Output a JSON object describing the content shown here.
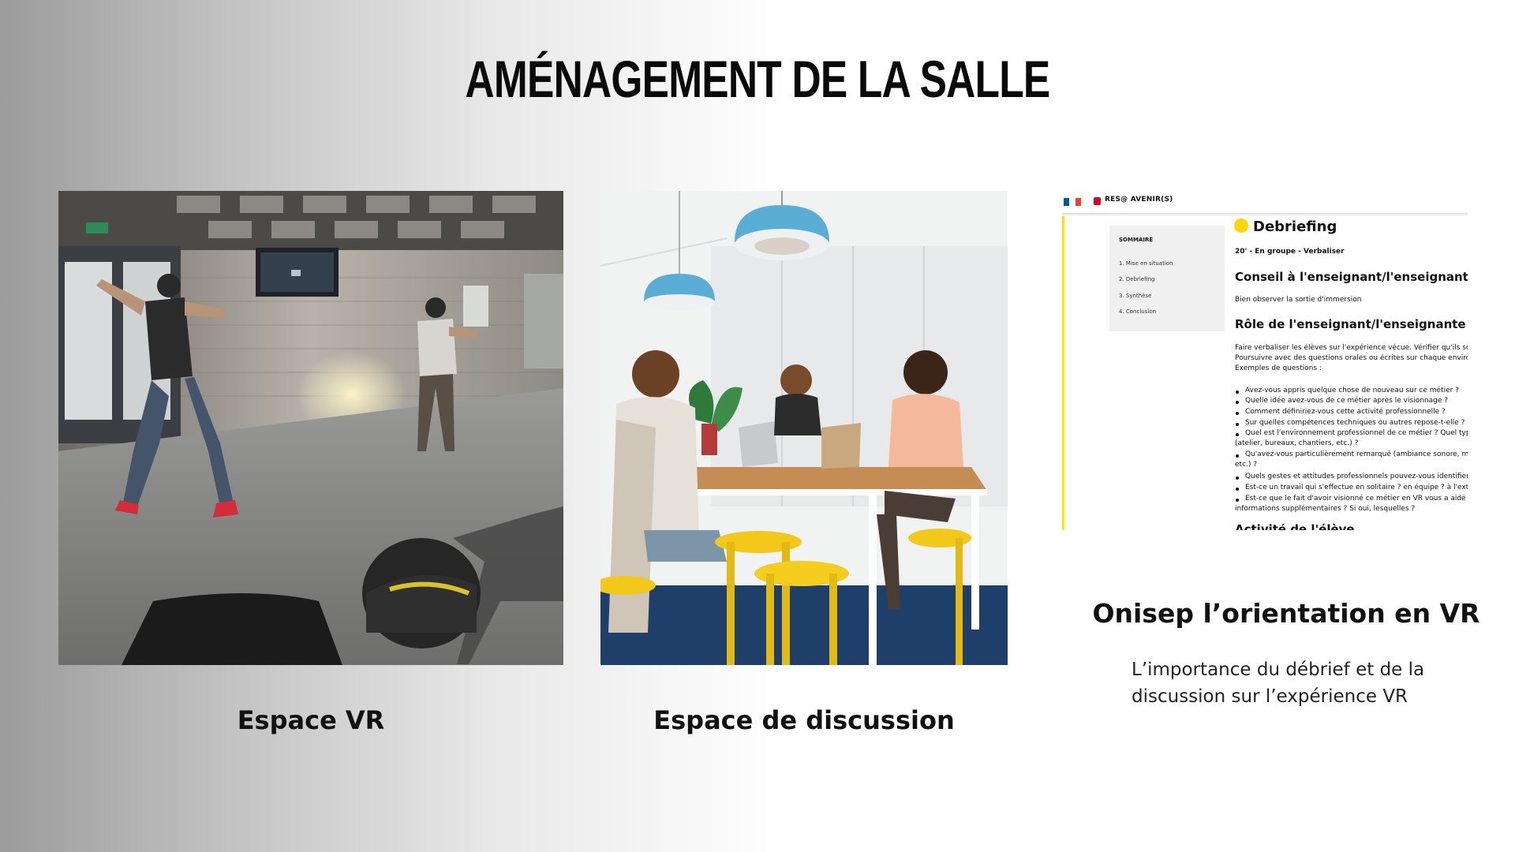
{
  "slide": {
    "title": "AMÉNAGEMENT DE LA SALLE"
  },
  "panels": {
    "vr": {
      "caption": "Espace VR"
    },
    "discussion": {
      "caption": "Espace de discussion"
    },
    "onisep": {
      "title": "Onisep l’orientation en VR",
      "description_line1": "L’importance du débrief et de la",
      "description_line2": "discussion sur l’expérience VR"
    }
  },
  "doc": {
    "logo_text": "RES@ AVENIR(S)",
    "sommaire_title": "SOMMAIRE",
    "sommaire_items": [
      "1. Mise en situation",
      "2. Debriefing",
      "3. Synthèse",
      "4. Conclusion"
    ],
    "heading": "Debriefing",
    "subheading": "20' - En groupe - Verbaliser",
    "section1_title": "Conseil à l'enseignant/l'enseignante",
    "section1_text": "Bien observer la sortie d'immersion",
    "section2_title": "Rôle de l'enseignant/l'enseignante",
    "section2_lines": [
      "Faire verbaliser les élèves sur l'expérience vécue. Vérifier qu'ils sont b",
      "Poursuivre avec des questions orales ou écrites sur chaque environne",
      "Exemples de questions :"
    ],
    "questions": [
      "Avez-vous appris quelque chose de nouveau sur ce métier ?",
      "Quelle idée avez-vous de ce métier après le visionnage ?",
      "Comment définiriez-vous cette activité professionnelle ?",
      "Sur quelles compétences techniques ou autres repose-t-elle ?",
      "Quel est l'environnement professionnel de ce métier ? Quel type",
      "Qu'avez-vous particulièrement remarqué (ambiance sonore, maté",
      "Quels gestes et attitudes professionnels pouvez-vous identifier ?",
      "Est-ce un travail qui s'effectue en solitaire ? en équipe ? à l'exté",
      "Est-ce que le fait d'avoir visionné ce métier en VR vous a aidé ? E"
    ],
    "continuations": [
      "(atelier, bureaux, chantiers, etc.) ?",
      "etc.) ?",
      "informations supplémentaires ? Si oui, lesquelles ?"
    ],
    "section3_title": "Activité de l'élève"
  },
  "colors": {
    "accent_yellow": "#ffd700",
    "flag_blue": "#0055a4",
    "flag_red": "#ef4135",
    "logo_red": "#c8102e"
  }
}
